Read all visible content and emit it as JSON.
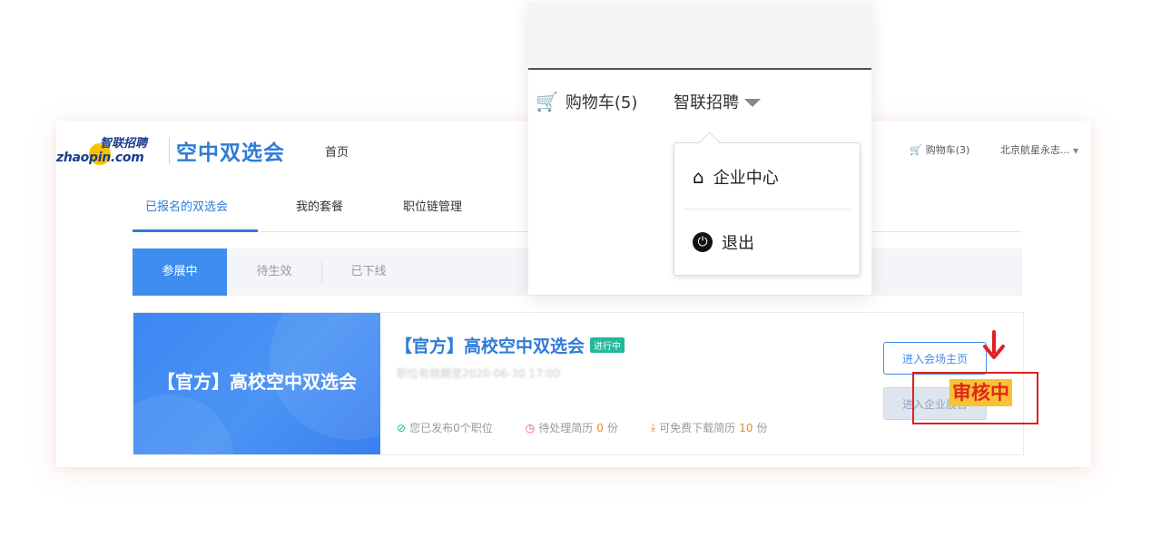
{
  "header": {
    "logo_text_en": "zhaopin.com",
    "logo_text_cn": "智联招聘",
    "product_name": "空中双选会",
    "nav_home": "首页",
    "cart_label": "购物车(3)",
    "user_label": "北京航星永志..."
  },
  "main_tabs": [
    {
      "label": "已报名的双选会"
    },
    {
      "label": "我的套餐"
    },
    {
      "label": "职位链管理"
    }
  ],
  "status_tabs": [
    {
      "label": "参展中"
    },
    {
      "label": "待生效"
    },
    {
      "label": "已下线"
    }
  ],
  "event": {
    "banner_title": "【官方】高校空中双选会",
    "title": "【官方】高校空中双选会",
    "status_badge": "进行中",
    "deadline": "职位有效期至2020-06-30 17:00",
    "stats": [
      {
        "label": "您已发布0个职位",
        "num": ""
      },
      {
        "label": "待处理简历 ",
        "num": "0",
        "suffix": "份"
      },
      {
        "label": "可免费下载简历 ",
        "num": "10",
        "suffix": "份"
      }
    ],
    "button_venue": "进入会场主页",
    "button_enterprise": "进入企业展台"
  },
  "zoom": {
    "cart_label": "购物车(5)",
    "user_menu_label": "智联招聘",
    "dropdown_items": [
      {
        "label": "企业中心",
        "icon": "home-icon"
      },
      {
        "label": "退出",
        "icon": "power-icon"
      }
    ]
  },
  "annotation": {
    "label": "审核中",
    "color": "#e02020",
    "highlight": "#f7c233"
  },
  "colors": {
    "accent": "#3d8ef0",
    "brand_blue": "#2f7bd9",
    "status_green": "#25b89a",
    "number_orange": "#f08a24"
  }
}
